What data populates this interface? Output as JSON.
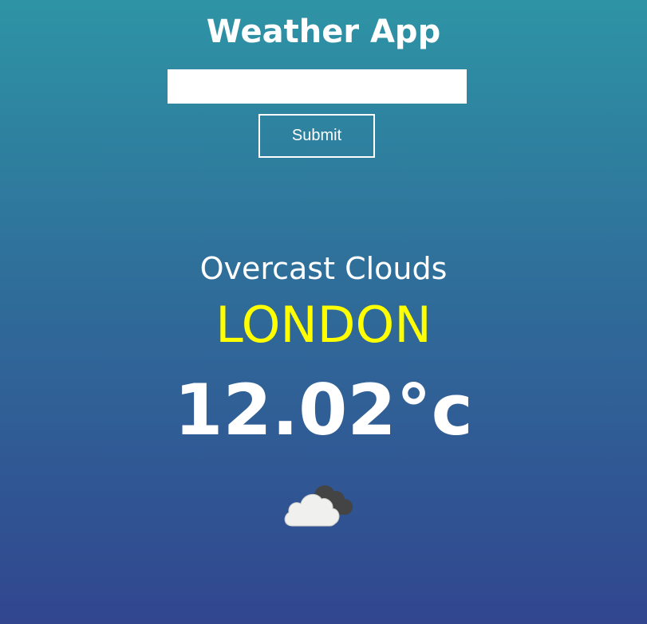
{
  "app": {
    "title": "Weather App"
  },
  "search": {
    "value": "",
    "placeholder": ""
  },
  "submit": {
    "label": "Submit"
  },
  "weather": {
    "description": "Overcast Clouds",
    "city": "LONDON",
    "temperature": "12.02°c",
    "icon": "overcast-clouds-icon"
  },
  "colors": {
    "background_top": "#2e94a5",
    "background_bottom": "#31468f",
    "city": "#ffff00",
    "text": "#ffffff"
  }
}
